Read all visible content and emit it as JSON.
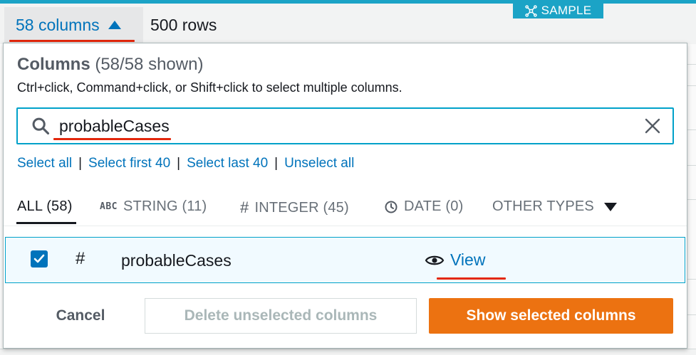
{
  "header": {
    "columns_toggle_label": "58 columns",
    "rows_label": "500 rows",
    "sample_badge_label": "SAMPLE"
  },
  "popover": {
    "title_bold": "Columns",
    "title_count": "(58/58 shown)",
    "hint": "Ctrl+click, Command+click, or Shift+click to select multiple columns.",
    "search": {
      "value": "probableCases",
      "icon": "search-icon",
      "clear_icon": "close-icon"
    },
    "select_links": [
      {
        "label": "Select all"
      },
      {
        "label": "Select first 40"
      },
      {
        "label": "Select last 40"
      },
      {
        "label": "Unselect all"
      }
    ],
    "type_tabs": [
      {
        "label": "ALL (58)",
        "active": true
      },
      {
        "icon_text": "ABC",
        "label": "STRING (11)"
      },
      {
        "icon_text": "#",
        "label": "INTEGER (45)"
      },
      {
        "icon": "clock-icon",
        "label": "DATE (0)"
      },
      {
        "label": "OTHER TYPES",
        "icon": "caret-down-icon"
      }
    ],
    "columns": [
      {
        "checked": true,
        "type_symbol": "#",
        "name": "probableCases",
        "view_label": "View"
      }
    ],
    "footer": {
      "cancel_label": "Cancel",
      "delete_label": "Delete unselected columns",
      "show_label": "Show selected columns"
    }
  },
  "colors": {
    "accent_blue": "#0073bb",
    "search_border": "#00a1c9",
    "primary_orange": "#ec7211",
    "annotation_red": "#e3270c",
    "top_strip": "#1ba3c6"
  }
}
